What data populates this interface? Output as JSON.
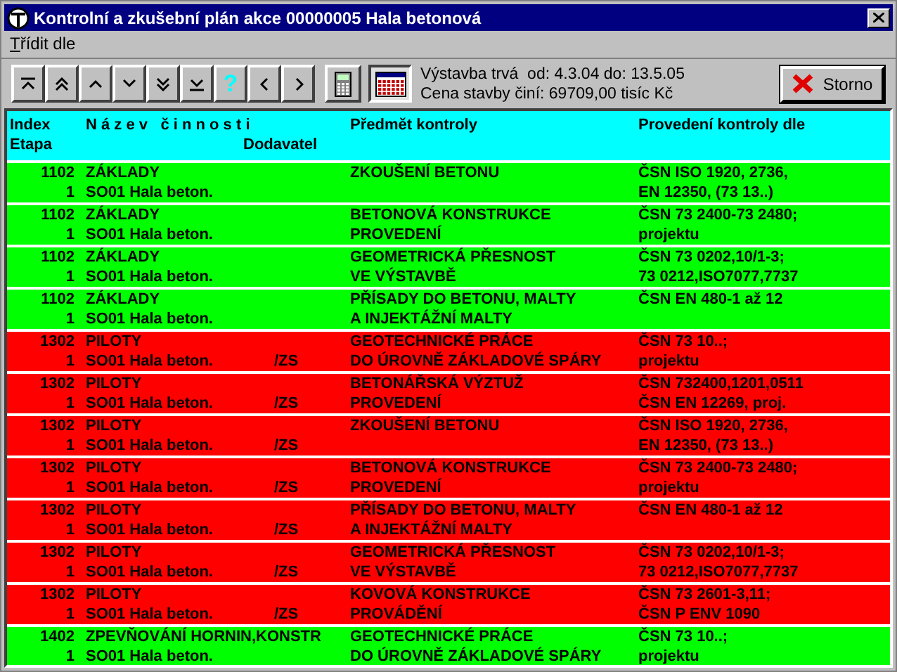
{
  "window": {
    "title": "Kontrolní a zkušební plán akce 00000005 Hala betonová"
  },
  "menu": [
    {
      "label": "Třídit dle"
    }
  ],
  "toolbar": [
    {
      "kind": "first"
    },
    {
      "kind": "page-up"
    },
    {
      "kind": "up"
    },
    {
      "kind": "down"
    },
    {
      "kind": "page-down"
    },
    {
      "kind": "last"
    },
    {
      "kind": "help",
      "label": "?"
    },
    {
      "kind": "prev"
    },
    {
      "kind": "next"
    },
    {
      "kind": "calculator"
    },
    {
      "kind": "calendar",
      "pressed": true
    }
  ],
  "info": [
    "Výstavba trvá  od: 4.3.04 do: 13.5.05",
    "Cena stavby činí: 69709,00 tisíc Kč"
  ],
  "cancel_button": "Storno",
  "header": {
    "index": "Index",
    "name": "N á z e v   č i n n o s t i",
    "subject": "Předmět kontroly",
    "standard": "Provedení kontroly dle",
    "stage": "Etapa",
    "supplier": "Dodavatel"
  },
  "rows": [
    {
      "index": "1102",
      "name": "ZÁKLADY",
      "stage": "1",
      "building": "SO01 Hala beton.",
      "subject": "ZKOUŠENÍ BETONU",
      "standard": "ČSN ISO 1920, 2736,\nEN 12350, (73 13..)",
      "color": "#00ff00"
    },
    {
      "index": "1102",
      "name": "ZÁKLADY",
      "stage": "1",
      "building": "SO01 Hala beton.",
      "subject": "BETONOVÁ KONSTRUKCE\nPROVEDENÍ",
      "standard": "ČSN 73 2400-73 2480;\nprojektu",
      "color": "#00ff00"
    },
    {
      "index": "1102",
      "name": "ZÁKLADY",
      "stage": "1",
      "building": "SO01 Hala beton.",
      "subject": "GEOMETRICKÁ PŘESNOST\nVE VÝSTAVBĚ",
      "standard": "ČSN 73 0202,10/1-3;\n73 0212,ISO7077,7737",
      "color": "#00ff00"
    },
    {
      "index": "1102",
      "name": "ZÁKLADY",
      "stage": "1",
      "building": "SO01 Hala beton.",
      "subject": "PŘÍSADY DO BETONU, MALTY\nA INJEKTÁŽNÍ MALTY",
      "standard": "ČSN EN 480-1 až 12",
      "color": "#00ff00"
    },
    {
      "index": "1302",
      "name": "PILOTY",
      "stage": "1",
      "building": "SO01 Hala beton.",
      "supplier": "/ZS",
      "subject": "GEOTECHNICKÉ PRÁCE\nDO ÚROVNĚ ZÁKLADOVÉ SPÁRY",
      "standard": "ČSN 73 10..;\nprojektu",
      "color": "#ff0000"
    },
    {
      "index": "1302",
      "name": "PILOTY",
      "stage": "1",
      "building": "SO01 Hala beton.",
      "supplier": "/ZS",
      "subject": "BETONÁŘSKÁ VÝZTUŽ\nPROVEDENÍ",
      "standard": "ČSN 732400,1201,0511\nČSN EN 12269, proj.",
      "color": "#ff0000"
    },
    {
      "index": "1302",
      "name": "PILOTY",
      "stage": "1",
      "building": "SO01 Hala beton.",
      "supplier": "/ZS",
      "subject": "ZKOUŠENÍ BETONU",
      "standard": "ČSN ISO 1920, 2736,\nEN 12350, (73 13..)",
      "color": "#ff0000"
    },
    {
      "index": "1302",
      "name": "PILOTY",
      "stage": "1",
      "building": "SO01 Hala beton.",
      "supplier": "/ZS",
      "subject": "BETONOVÁ KONSTRUKCE\nPROVEDENÍ",
      "standard": "ČSN 73 2400-73 2480;\nprojektu",
      "color": "#ff0000"
    },
    {
      "index": "1302",
      "name": "PILOTY",
      "stage": "1",
      "building": "SO01 Hala beton.",
      "supplier": "/ZS",
      "subject": "PŘÍSADY DO BETONU, MALTY\nA INJEKTÁŽNÍ MALTY",
      "standard": "ČSN EN 480-1 až 12",
      "color": "#ff0000"
    },
    {
      "index": "1302",
      "name": "PILOTY",
      "stage": "1",
      "building": "SO01 Hala beton.",
      "supplier": "/ZS",
      "subject": "GEOMETRICKÁ PŘESNOST\nVE VÝSTAVBĚ",
      "standard": "ČSN 73 0202,10/1-3;\n73 0212,ISO7077,7737",
      "color": "#ff0000"
    },
    {
      "index": "1302",
      "name": "PILOTY",
      "stage": "1",
      "building": "SO01 Hala beton.",
      "supplier": "/ZS",
      "subject": "KOVOVÁ KONSTRUKCE\nPROVÁDĚNÍ",
      "standard": "ČSN 73 2601-3,11;\nČSN P ENV 1090",
      "color": "#ff0000"
    },
    {
      "index": "1402",
      "name": "ZPEVŇOVÁNÍ HORNIN,KONSTR",
      "stage": "1",
      "building": "SO01 Hala beton.",
      "subject": "GEOTECHNICKÉ PRÁCE\nDO ÚROVNĚ ZÁKLADOVÉ SPÁRY",
      "standard": "ČSN 73 10..;\nprojektu",
      "color": "#00ff00"
    }
  ]
}
